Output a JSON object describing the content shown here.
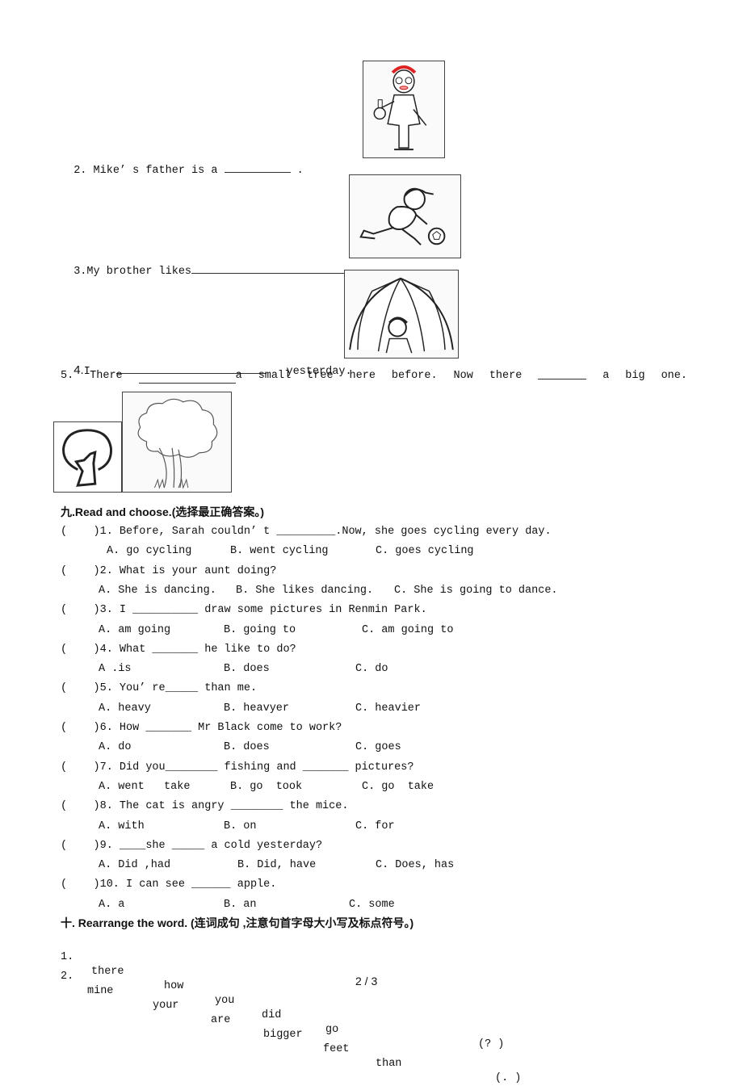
{
  "section_pictures": {
    "q2": {
      "number": "2.",
      "text_before": "Mike’ s father is a",
      "text_after": "."
    },
    "q3": {
      "number": "3.",
      "text_before": "My brother likes",
      "text_after": "."
    },
    "q4": {
      "number": "4.",
      "text_before": "I",
      "text_after": "yesterday."
    },
    "q5": {
      "words": [
        "5.",
        "There",
        "",
        "a",
        "small",
        "tree",
        "here",
        "before.",
        "Now",
        "there",
        "",
        "a",
        "big",
        "one."
      ]
    }
  },
  "section9": {
    "heading": "九.Read and choose.(选择最正确答案。)",
    "questions": [
      {
        "stem": "(    )1. Before, Sarah couldn’ t _________.Now, she goes cycling every day.",
        "options": [
          "A. go cycling",
          "B. went cycling",
          "C. goes cycling"
        ]
      },
      {
        "stem": "(    )2. What is your aunt doing?",
        "options": [
          "A. She is dancing.",
          "B. She likes dancing.",
          "C. She is going to dance."
        ]
      },
      {
        "stem": "(    )3. I __________ draw some pictures in Renmin Park.",
        "options": [
          "A. am going",
          "B. going to",
          "C. am going to"
        ]
      },
      {
        "stem": "(    )4. What _______ he like to do?",
        "options": [
          "A .is",
          "B. does",
          "C. do"
        ]
      },
      {
        "stem": "(    )5. You’ re_____ than me.",
        "options": [
          "A. heavy",
          "B. heavyer",
          "C. heavier"
        ]
      },
      {
        "stem": "(    )6. How _______ Mr Black come to work?",
        "options": [
          "A. do",
          "B. does",
          "C. goes"
        ]
      },
      {
        "stem": "(    )7. Did you________ fishing and _______ pictures?",
        "options": [
          "A. went   take",
          "B. go  took",
          "C. go  take"
        ]
      },
      {
        "stem": "(    )8. The cat is angry ________ the mice.",
        "options": [
          "A. with",
          "B. on",
          "C. for"
        ]
      },
      {
        "stem": "(    )9. ____she _____ a cold yesterday?",
        "options": [
          "A. Did ,had",
          "B. Did, have",
          "C. Does, has"
        ]
      },
      {
        "stem": "(    )10. I can see ______ apple.",
        "options": [
          "A. a",
          "B. an",
          "C. some"
        ]
      }
    ]
  },
  "section10": {
    "heading": "十. Rearrange the word. (连词成句 ,注意句首字母大小写及标点符号。)",
    "items": [
      {
        "number": "1.",
        "words": [
          "there",
          "how",
          "you",
          "did",
          "go"
        ],
        "punct": "(? )"
      },
      {
        "number": "2.",
        "words": [
          "mine",
          "your",
          "are",
          "bigger",
          "feet",
          "than"
        ],
        "punct": "(. )"
      }
    ]
  },
  "footer": {
    "page": "2 / 3"
  }
}
